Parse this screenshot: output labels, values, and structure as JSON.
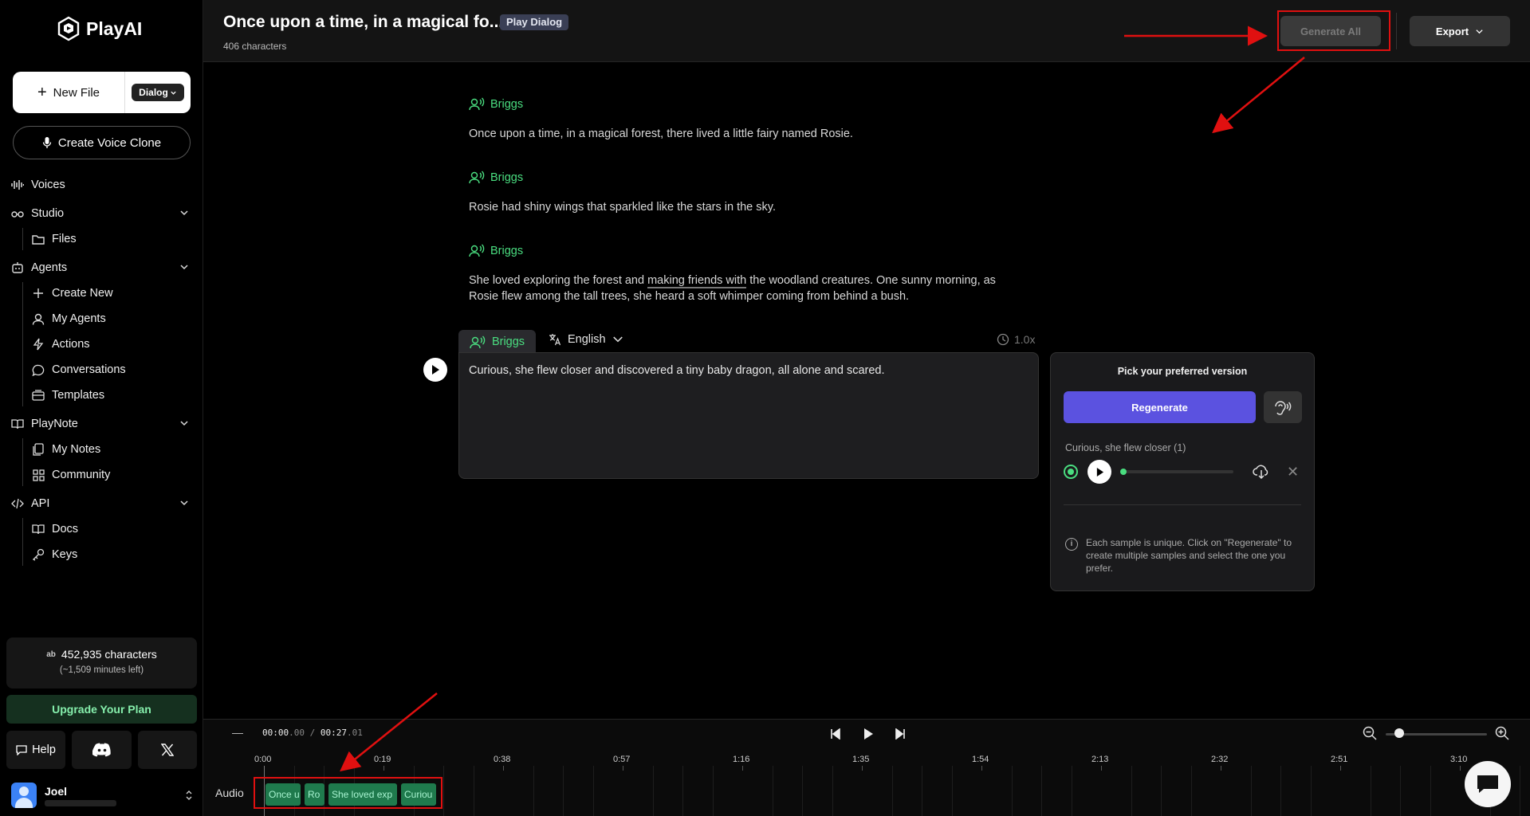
{
  "app": {
    "name": "PlayAI"
  },
  "sidebar": {
    "new_file_label": "New File",
    "new_file_type": "Dialog",
    "voice_clone_label": "Create Voice Clone",
    "voices": "Voices",
    "studio": "Studio",
    "files": "Files",
    "agents": "Agents",
    "create_new": "Create New",
    "my_agents": "My Agents",
    "actions": "Actions",
    "conversations": "Conversations",
    "templates": "Templates",
    "playnote": "PlayNote",
    "my_notes": "My Notes",
    "community": "Community",
    "api": "API",
    "docs": "Docs",
    "keys": "Keys",
    "credits_icon": "ab",
    "credits": "452,935 characters",
    "minutes_left": "(~1,509 minutes left)",
    "upgrade": "Upgrade Your Plan",
    "help": "Help",
    "user_name": "Joel"
  },
  "header": {
    "title": "Once upon a time, in a magical fo...",
    "badge": "Play Dialog",
    "char_count": "406 characters",
    "generate_all": "Generate All",
    "export": "Export"
  },
  "dialog": {
    "lines": [
      {
        "speaker": "Briggs",
        "text": "Once upon a time, in a magical forest, there lived a little fairy named Rosie."
      },
      {
        "speaker": "Briggs",
        "text": "Rosie had shiny wings that sparkled like the stars in the sky."
      },
      {
        "speaker": "Briggs",
        "text_before": "She loved exploring the forest and ",
        "text_underlined": "making friends with",
        "text_after": " the woodland creatures. One sunny morning, as Rosie flew among the tall trees, she heard a soft whimper coming from behind a bush."
      }
    ],
    "active": {
      "speaker": "Briggs",
      "language": "English",
      "speed": "1.0x",
      "text": "Curious, she flew closer and discovered a tiny baby dragon, all alone and scared."
    }
  },
  "version_panel": {
    "title": "Pick your preferred version",
    "regenerate": "Regenerate",
    "sample_label": "Curious, she flew closer (1)",
    "progress": 0.0,
    "info": "Each sample is unique. Click on \"Regenerate\" to create multiple samples and select the one you prefer."
  },
  "timeline": {
    "current_time_main": "00:00",
    "current_time_frac": ".00",
    "separator": " / ",
    "total_time_main": "00:27",
    "total_time_frac": ".01",
    "zoom_level": 0.13,
    "ruler": [
      "0:00",
      "0:19",
      "0:38",
      "0:57",
      "1:16",
      "1:35",
      "1:54",
      "2:13",
      "2:32",
      "2:51",
      "3:10"
    ],
    "track_label": "Audio",
    "clips": [
      "Once u",
      "Ro",
      "She loved exp",
      "Curiou"
    ]
  },
  "colors": {
    "accent_green": "#4ade80",
    "regenerate": "#5b52e0",
    "annotation_red": "#e01010"
  }
}
